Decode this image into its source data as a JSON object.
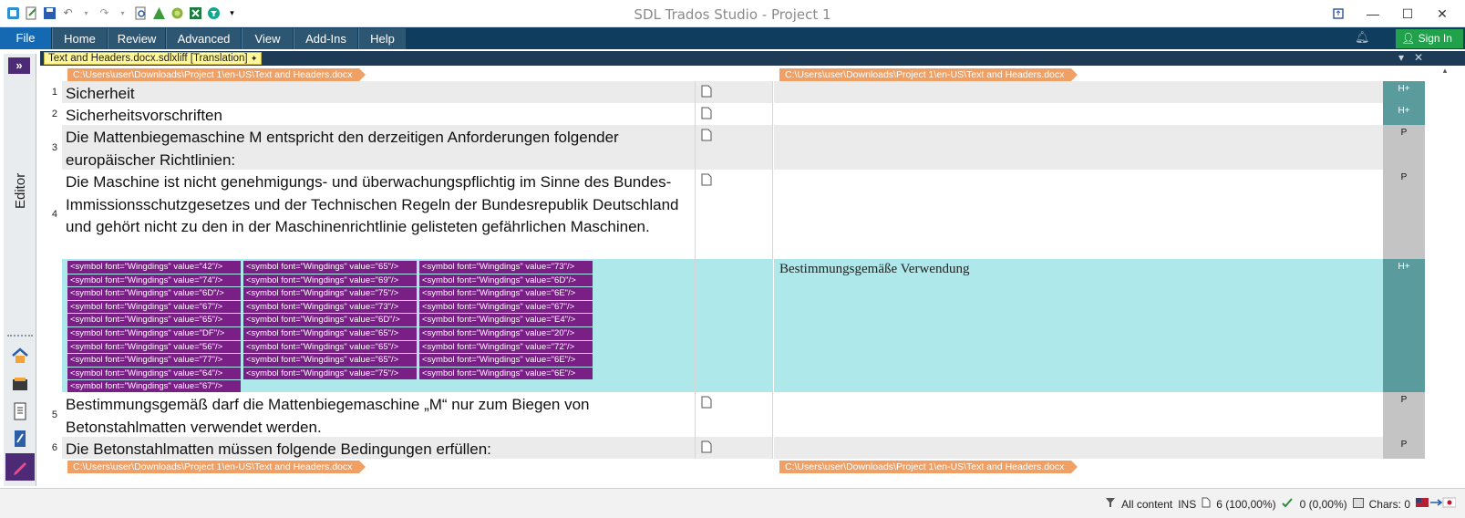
{
  "window": {
    "title": "SDL Trados Studio - Project 1"
  },
  "ribbon": {
    "file": "File",
    "tabs": [
      "Home",
      "Review",
      "Advanced",
      "View",
      "Add-Ins",
      "Help"
    ],
    "signin": "Sign In"
  },
  "sidebar": {
    "label": "Editor",
    "expand": "»"
  },
  "document": {
    "tab_label": "Text and Headers.docx.sdlxliff [Translation]"
  },
  "file_header": {
    "path": "C:\\Users\\user\\Downloads\\Project 1\\en-US\\Text and Headers.docx"
  },
  "segments": [
    {
      "num": "1",
      "source": "Sicherheit",
      "target": "",
      "badge": "H+"
    },
    {
      "num": "2",
      "source": "Sicherheitsvorschriften",
      "target": "",
      "badge": "H+"
    },
    {
      "num": "3",
      "source": "Die Mattenbiegemaschine M entspricht den derzeitigen Anforderungen folgender europäischer Richtlinien:",
      "target": "",
      "badge": "P"
    },
    {
      "num": "4",
      "source": "Die Maschine ist nicht genehmigungs- und überwachungspflichtig im Sinne des Bundes-Immissionsschutzgesetzes und der Technischen Regeln der Bundesrepublik Deutschland und gehört nicht zu den in der Maschinenrichtlinie gelisteten gefährlichen Maschinen.",
      "target": "",
      "badge": "P"
    },
    {
      "num": "",
      "source": "",
      "target": "Bestimmungsgemäße Verwendung",
      "badge": "H+"
    },
    {
      "num": "5",
      "source": "Bestimmungsgemäß darf die Mattenbiegemaschine „M“ nur zum Biegen von Betonstahlmatten verwendet werden.",
      "target": "",
      "badge": "P"
    },
    {
      "num": "6",
      "source": "Die Betonstahlmatten müssen folgende Bedingungen erfüllen:",
      "target": "",
      "badge": "P"
    }
  ],
  "tags": [
    "<symbol font=\"Wingdings\" value=\"42\"/>",
    "<symbol font=\"Wingdings\" value=\"65\"/>",
    "<symbol font=\"Wingdings\" value=\"73\"/>",
    "<symbol font=\"Wingdings\" value=\"74\"/>",
    "<symbol font=\"Wingdings\" value=\"69\"/>",
    "<symbol font=\"Wingdings\" value=\"6D\"/>",
    "<symbol font=\"Wingdings\" value=\"6D\"/>",
    "<symbol font=\"Wingdings\" value=\"75\"/>",
    "<symbol font=\"Wingdings\" value=\"6E\"/>",
    "<symbol font=\"Wingdings\" value=\"67\"/>",
    "<symbol font=\"Wingdings\" value=\"73\"/>",
    "<symbol font=\"Wingdings\" value=\"67\"/>",
    "<symbol font=\"Wingdings\" value=\"65\"/>",
    "<symbol font=\"Wingdings\" value=\"6D\"/>",
    "<symbol font=\"Wingdings\" value=\"E4\"/>",
    "<symbol font=\"Wingdings\" value=\"DF\"/>",
    "<symbol font=\"Wingdings\" value=\"65\"/>",
    "<symbol font=\"Wingdings\" value=\"20\"/>",
    "<symbol font=\"Wingdings\" value=\"56\"/>",
    "<symbol font=\"Wingdings\" value=\"65\"/>",
    "<symbol font=\"Wingdings\" value=\"72\"/>",
    "<symbol font=\"Wingdings\" value=\"77\"/>",
    "<symbol font=\"Wingdings\" value=\"65\"/>",
    "<symbol font=\"Wingdings\" value=\"6E\"/>",
    "<symbol font=\"Wingdings\" value=\"64\"/>",
    "<symbol font=\"Wingdings\" value=\"75\"/>",
    "<symbol font=\"Wingdings\" value=\"6E\"/>",
    "<symbol font=\"Wingdings\" value=\"67\"/>"
  ],
  "statusbar": {
    "filter": "All content",
    "mode": "INS",
    "segments": "6 (100,00%)",
    "confirmed": "0 (0,00%)",
    "chars": "Chars: 0"
  },
  "icons": {
    "filter": "funnel-icon",
    "segments": "document-icon",
    "confirmed": "check-pen-icon",
    "chars": "keyboard-icon",
    "language": "flag-icon"
  },
  "colors": {
    "ribbon": "#0f3d5e",
    "file_tab": "#1569b2",
    "signin": "#21a14c",
    "active_row": "#aee8ea",
    "tag": "#7a1f86",
    "file_header": "#f0a065",
    "badge_h": "#5a9b9e"
  }
}
